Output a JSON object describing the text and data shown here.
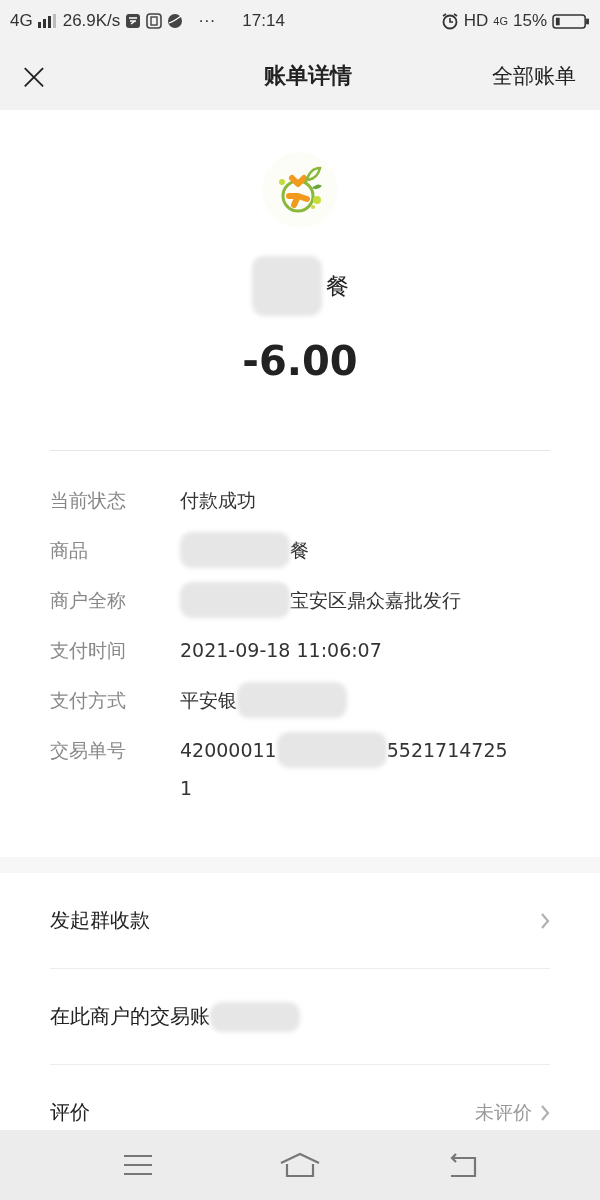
{
  "status_bar": {
    "network": "4G",
    "speed": "26.9K/s",
    "more": "···",
    "time": "17:14",
    "hd": "HD",
    "network_right": "4G",
    "battery": "15%"
  },
  "header": {
    "close": "×",
    "title": "账单详情",
    "all_bills": "全部账单"
  },
  "summary": {
    "merchant": [
      {
        "kind": "blur"
      },
      {
        "kind": "text",
        "text": "餐"
      }
    ],
    "amount": "-6.00"
  },
  "details": [
    {
      "label": "当前状态",
      "segments": [
        {
          "kind": "text",
          "text": "付款成功"
        }
      ]
    },
    {
      "label": "商品",
      "segments": [
        {
          "kind": "blur"
        },
        {
          "kind": "text",
          "text": "餐"
        }
      ]
    },
    {
      "label": "商户全称",
      "segments": [
        {
          "kind": "blur"
        },
        {
          "kind": "text",
          "text": "宝安区鼎众嘉批发行"
        }
      ]
    },
    {
      "label": "支付时间",
      "segments": [
        {
          "kind": "text",
          "text": "2021-09-18 11:06:07"
        }
      ]
    },
    {
      "label": "支付方式",
      "segments": [
        {
          "kind": "text",
          "text": "平安银"
        },
        {
          "kind": "blur"
        }
      ]
    },
    {
      "label": "交易单号",
      "segments": [
        {
          "kind": "text",
          "text": "42000011"
        },
        {
          "kind": "blur"
        },
        {
          "kind": "text",
          "text": "5521714725"
        },
        {
          "kind": "break"
        },
        {
          "kind": "text",
          "text": "1"
        }
      ]
    }
  ],
  "actions": [
    {
      "label": "发起群收款",
      "chevron": true,
      "blur": false
    },
    {
      "label": "在此商户的交易账",
      "chevron": false,
      "blur": true
    },
    {
      "label": "评价",
      "value": "未评价",
      "chevron": true,
      "blur": false
    }
  ]
}
